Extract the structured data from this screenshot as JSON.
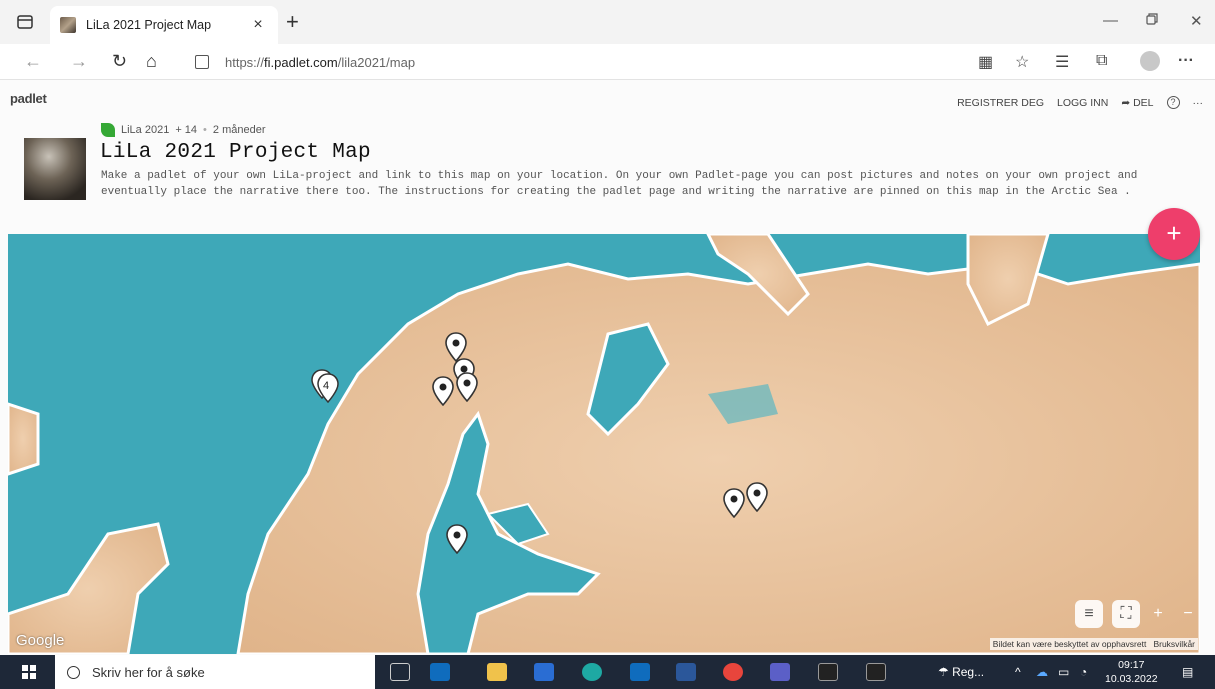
{
  "browser": {
    "tab_title": "LiLa 2021 Project Map",
    "tab_close": "×",
    "new_tab": "+",
    "url_prefix": "https://",
    "url_host": "fi.padlet.com",
    "url_path": "/lila2021/map"
  },
  "padlet": {
    "logo": "padlet",
    "actions": {
      "register": "REGISTRER DEG",
      "login": "LOGG INN",
      "share": "DEL",
      "help": "?",
      "more": "···"
    },
    "author": "LiLa 2021",
    "contributors": "+ 14",
    "separator": "•",
    "age": "2 måneder",
    "title": "LiLa 2021 Project Map",
    "description": "Make a padlet of your own LiLa-project and link to this map on your location. On your own Padlet-page you can post pictures and notes on your own project and eventually place the narrative there too. The instructions for creating the padlet page and writing the narrative are pinned on this map in the Arctic Sea .",
    "add_button": "+"
  },
  "map": {
    "provider_label": "Google",
    "copyright": "Bildet kan være beskyttet av opphavsrett",
    "terms": "Bruksvilkår",
    "cluster_count": "4",
    "controls": {
      "zoom_in": "+",
      "zoom_out": "−"
    }
  },
  "taskbar": {
    "search_placeholder": "Skriv her for å søke",
    "weather": "Reg...",
    "time": "09:17",
    "date": "10.03.2022"
  },
  "colors": {
    "fab": "#ee3e6b",
    "sea": "#3ea8b8",
    "land": "#e8c29a"
  }
}
